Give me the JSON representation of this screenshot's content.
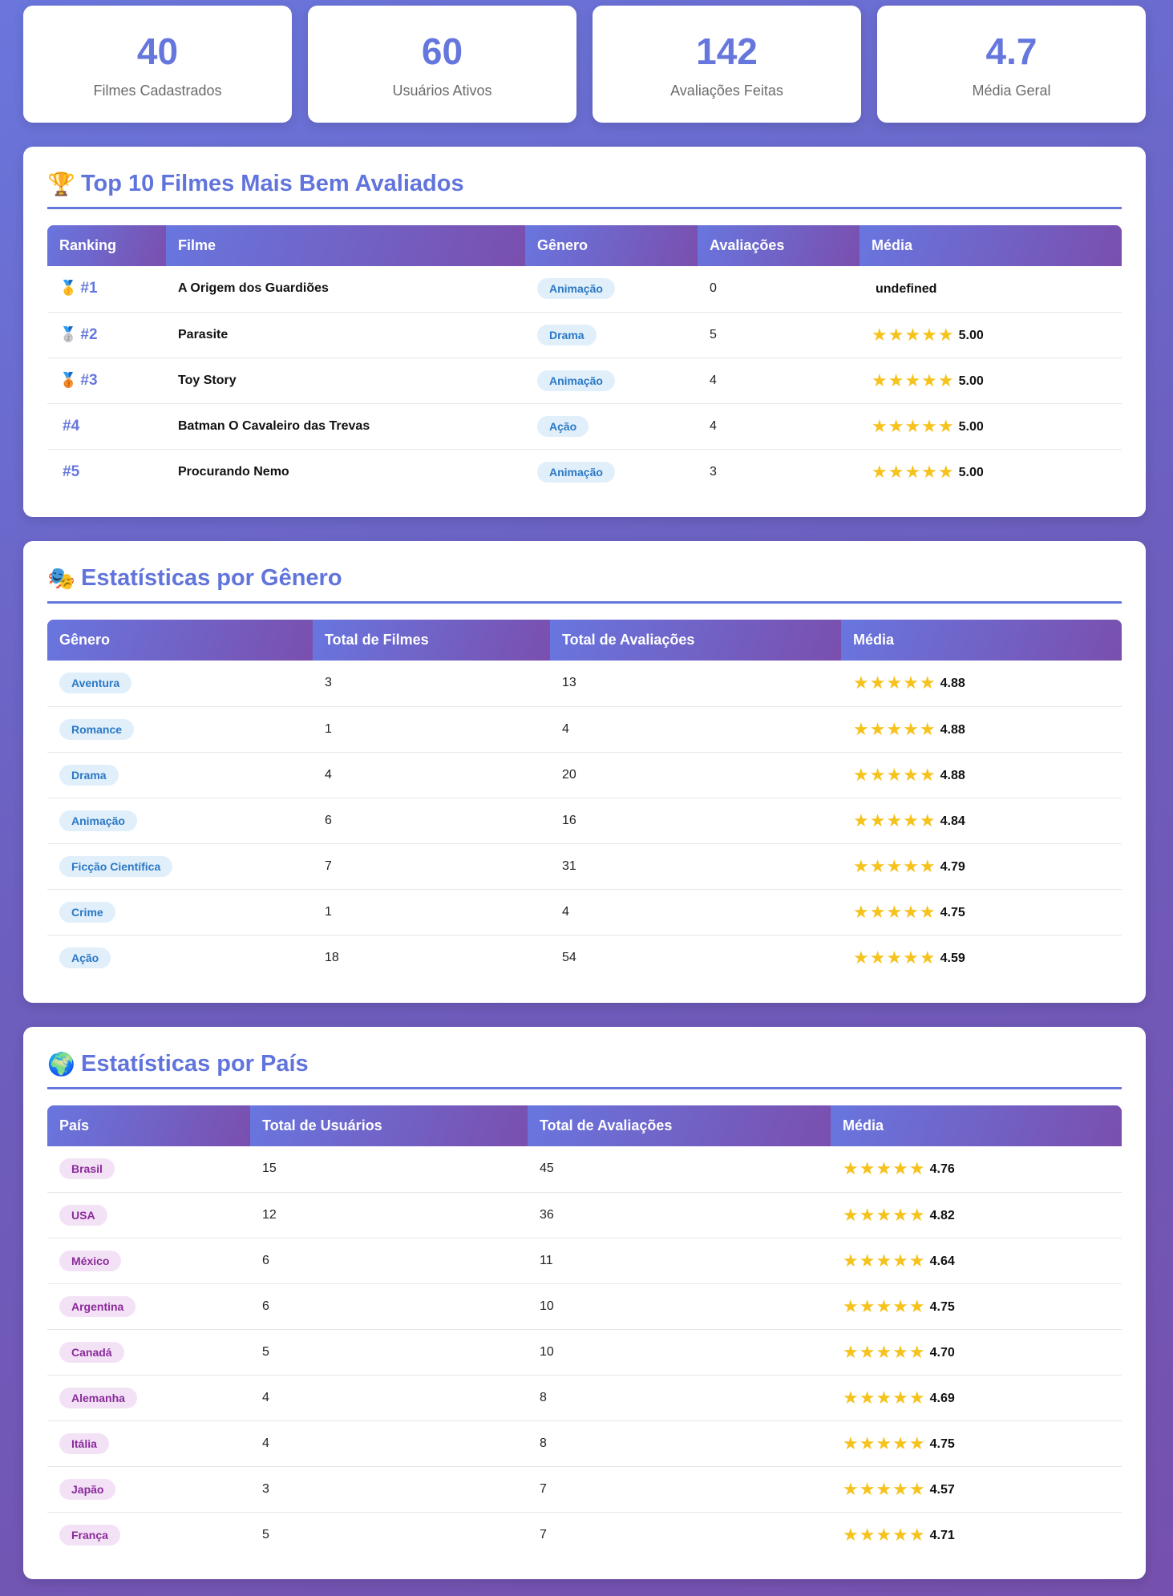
{
  "stats": [
    {
      "value": "40",
      "label": "Filmes Cadastrados"
    },
    {
      "value": "60",
      "label": "Usuários Ativos"
    },
    {
      "value": "142",
      "label": "Avaliações Feitas"
    },
    {
      "value": "4.7",
      "label": "Média Geral"
    }
  ],
  "top": {
    "icon": "trophy-icon",
    "icon_glyph": "🏆",
    "title": "Top 10 Filmes Mais Bem Avaliados",
    "headers": [
      "Ranking",
      "Filme",
      "Gênero",
      "Avaliações",
      "Média"
    ],
    "rows": [
      {
        "medal": "🥇",
        "rank": "#1",
        "film": "A Origem dos Guardiões",
        "genre": "Animação",
        "count": "0",
        "stars": "",
        "avg": "undefined"
      },
      {
        "medal": "🥈",
        "rank": "#2",
        "film": "Parasite",
        "genre": "Drama",
        "count": "5",
        "stars": "★★★★★",
        "avg": "5.00"
      },
      {
        "medal": "🥉",
        "rank": "#3",
        "film": "Toy Story",
        "genre": "Animação",
        "count": "4",
        "stars": "★★★★★",
        "avg": "5.00"
      },
      {
        "medal": "",
        "rank": "#4",
        "film": "Batman O Cavaleiro das Trevas",
        "genre": "Ação",
        "count": "4",
        "stars": "★★★★★",
        "avg": "5.00"
      },
      {
        "medal": "",
        "rank": "#5",
        "film": "Procurando Nemo",
        "genre": "Animação",
        "count": "3",
        "stars": "★★★★★",
        "avg": "5.00"
      }
    ]
  },
  "genres": {
    "icon": "theater-masks-icon",
    "icon_glyph": "🎭",
    "title": "Estatísticas por Gênero",
    "headers": [
      "Gênero",
      "Total de Filmes",
      "Total de Avaliações",
      "Média"
    ],
    "rows": [
      {
        "genre": "Aventura",
        "films": "3",
        "ratings": "13",
        "stars": "★★★★★",
        "avg": "4.88"
      },
      {
        "genre": "Romance",
        "films": "1",
        "ratings": "4",
        "stars": "★★★★★",
        "avg": "4.88"
      },
      {
        "genre": "Drama",
        "films": "4",
        "ratings": "20",
        "stars": "★★★★★",
        "avg": "4.88"
      },
      {
        "genre": "Animação",
        "films": "6",
        "ratings": "16",
        "stars": "★★★★★",
        "avg": "4.84"
      },
      {
        "genre": "Ficção Científica",
        "films": "7",
        "ratings": "31",
        "stars": "★★★★★",
        "avg": "4.79"
      },
      {
        "genre": "Crime",
        "films": "1",
        "ratings": "4",
        "stars": "★★★★★",
        "avg": "4.75"
      },
      {
        "genre": "Ação",
        "films": "18",
        "ratings": "54",
        "stars": "★★★★★",
        "avg": "4.59"
      }
    ]
  },
  "countries": {
    "icon": "globe-icon",
    "icon_glyph": "🌍",
    "title": "Estatísticas por País",
    "headers": [
      "País",
      "Total de Usuários",
      "Total de Avaliações",
      "Média"
    ],
    "rows": [
      {
        "country": "Brasil",
        "users": "15",
        "ratings": "45",
        "stars": "★★★★★",
        "avg": "4.76"
      },
      {
        "country": "USA",
        "users": "12",
        "ratings": "36",
        "stars": "★★★★★",
        "avg": "4.82"
      },
      {
        "country": "México",
        "users": "6",
        "ratings": "11",
        "stars": "★★★★★",
        "avg": "4.64"
      },
      {
        "country": "Argentina",
        "users": "6",
        "ratings": "10",
        "stars": "★★★★★",
        "avg": "4.75"
      },
      {
        "country": "Canadá",
        "users": "5",
        "ratings": "10",
        "stars": "★★★★★",
        "avg": "4.70"
      },
      {
        "country": "Alemanha",
        "users": "4",
        "ratings": "8",
        "stars": "★★★★★",
        "avg": "4.69"
      },
      {
        "country": "Itália",
        "users": "4",
        "ratings": "8",
        "stars": "★★★★★",
        "avg": "4.75"
      },
      {
        "country": "Japão",
        "users": "3",
        "ratings": "7",
        "stars": "★★★★★",
        "avg": "4.57"
      },
      {
        "country": "França",
        "users": "5",
        "ratings": "7",
        "stars": "★★★★★",
        "avg": "4.71"
      }
    ]
  },
  "colors": {
    "accent": "#6577dd",
    "header_gradient_start": "#6876df",
    "header_gradient_end": "#7a4fae",
    "genre_pill_bg": "#e1effb",
    "genre_pill_text": "#2a78c4",
    "country_pill_bg": "#f3e2f6",
    "country_pill_text": "#8a2a9a",
    "star": "#f6c21c"
  }
}
